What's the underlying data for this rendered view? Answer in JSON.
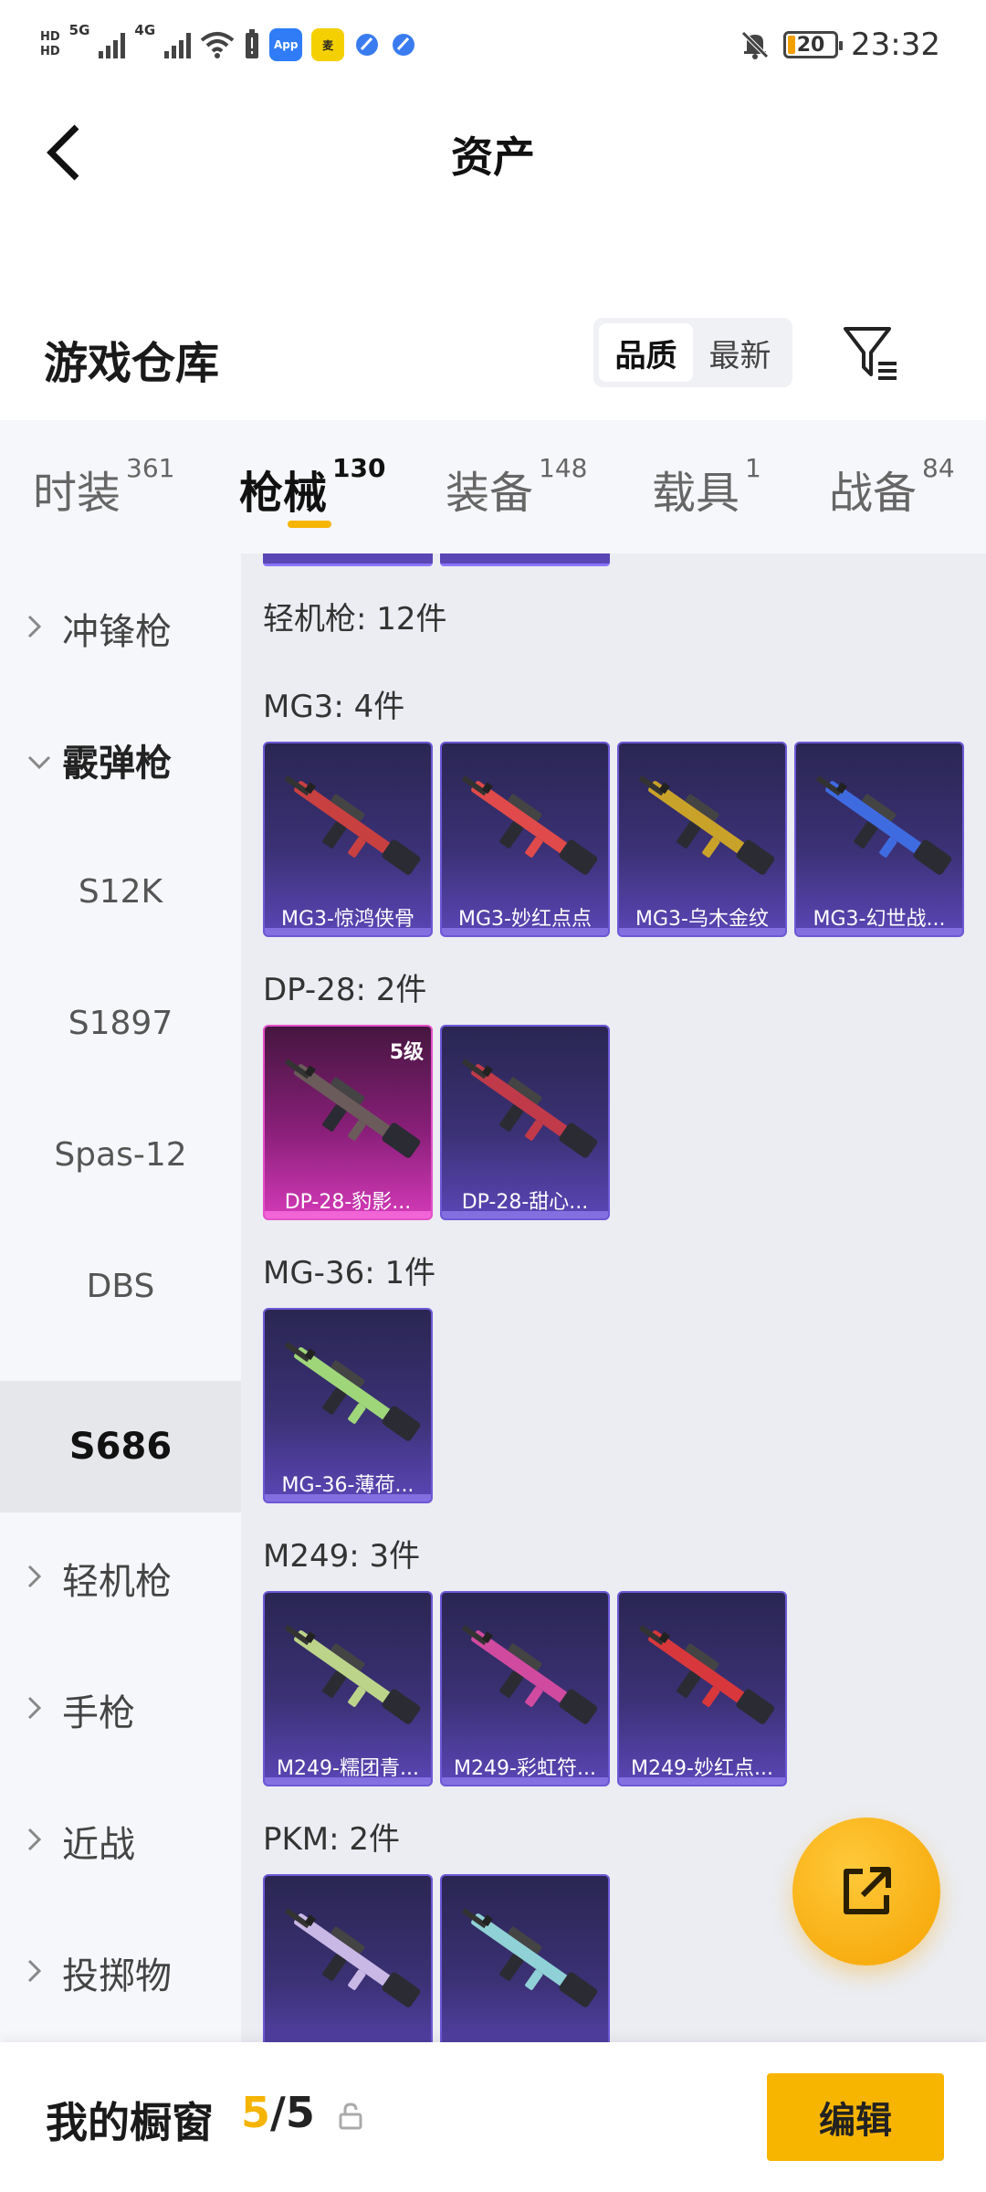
{
  "status_bar": {
    "hd1": "HD",
    "hd2": "HD",
    "net1": "5G",
    "net2": "4G",
    "battery": "20",
    "time": "23:32",
    "app_icons": [
      "app-store-icon",
      "game-icon",
      "blue-app-icon",
      "blue-app-icon-2"
    ]
  },
  "header": {
    "title": "资产"
  },
  "warehouse": {
    "title": "游戏仓库",
    "sort_options": [
      "品质",
      "最新"
    ],
    "active_sort": "品质"
  },
  "tabs": [
    {
      "label": "时装",
      "count": "361"
    },
    {
      "label": "枪械",
      "count": "130"
    },
    {
      "label": "装备",
      "count": "148"
    },
    {
      "label": "载具",
      "count": "1"
    },
    {
      "label": "战备",
      "count": "84"
    }
  ],
  "sidebar": {
    "items": [
      {
        "label": "冲锋枪",
        "type": "category"
      },
      {
        "label": "霰弹枪",
        "type": "category-open"
      },
      {
        "label": "S12K",
        "type": "sub"
      },
      {
        "label": "S1897",
        "type": "sub"
      },
      {
        "label": "Spas-12",
        "type": "sub"
      },
      {
        "label": "DBS",
        "type": "sub"
      },
      {
        "label": "S686",
        "type": "sub-selected"
      },
      {
        "label": "轻机枪",
        "type": "category"
      },
      {
        "label": "手枪",
        "type": "category"
      },
      {
        "label": "近战",
        "type": "category"
      },
      {
        "label": "投掷物",
        "type": "category"
      }
    ]
  },
  "content": {
    "group_title": "轻机枪: 12件",
    "sections": [
      {
        "title": "MG3: 4件",
        "items": [
          {
            "name": "MG3-惊鸿侠骨",
            "color": "#c94040"
          },
          {
            "name": "MG3-妙红点点",
            "color": "#e04a4a"
          },
          {
            "name": "MG3-乌木金纹",
            "color": "#c9a22a"
          },
          {
            "name": "MG3-幻世战...",
            "color": "#3f6be0"
          }
        ]
      },
      {
        "title": "DP-28: 2件",
        "items": [
          {
            "name": "DP-28-豹影...",
            "color": "#6b5b5b",
            "level": "5级",
            "rarity": "pink"
          },
          {
            "name": "DP-28-甜心...",
            "color": "#c03a4a"
          }
        ]
      },
      {
        "title": "MG-36: 1件",
        "items": [
          {
            "name": "MG-36-薄荷...",
            "color": "#9fd67a"
          }
        ]
      },
      {
        "title": "M249: 3件",
        "items": [
          {
            "name": "M249-糯团青...",
            "color": "#bcd48a"
          },
          {
            "name": "M249-彩虹符...",
            "color": "#d04aa0"
          },
          {
            "name": "M249-妙红点...",
            "color": "#d8383c"
          }
        ]
      },
      {
        "title": "PKM: 2件",
        "items": [
          {
            "name": "",
            "color": "#c9b8e6"
          },
          {
            "name": "",
            "color": "#8fd1d6"
          }
        ]
      }
    ]
  },
  "bottom_bar": {
    "label": "我的橱窗",
    "current": "5",
    "separator": "/",
    "total": "5",
    "edit_label": "编辑"
  },
  "colors": {
    "accent": "#f5b400",
    "card_bg": "#3b3175",
    "card_border": "#6d58d6",
    "pink_card": "#d43ab8"
  }
}
